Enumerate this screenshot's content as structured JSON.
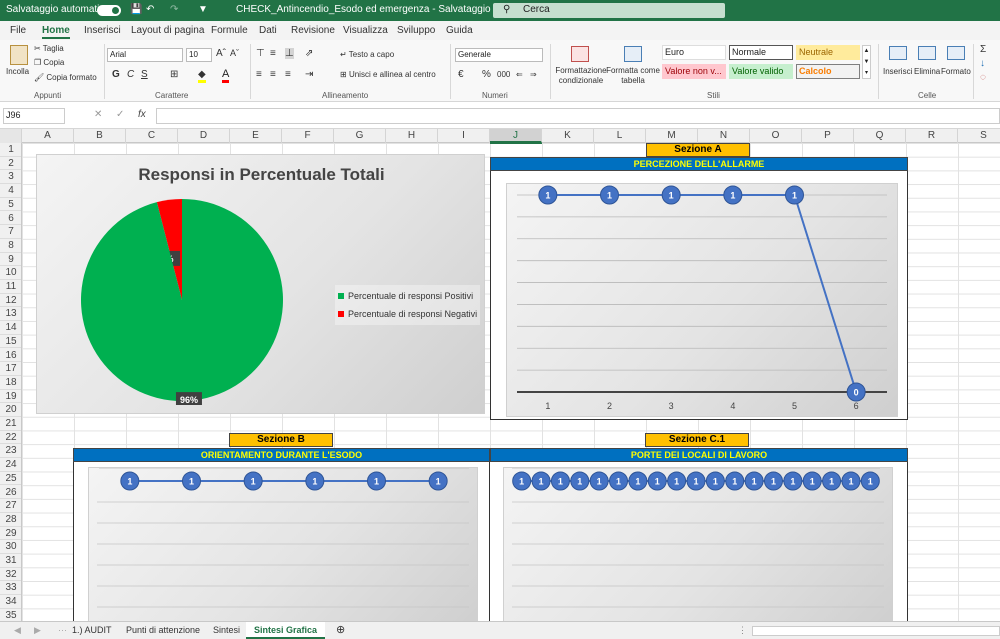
{
  "titlebar": {
    "autosave": "Salvataggio automatico",
    "filename": "CHECK_Antincendio_Esodo ed emergenza - Salvataggio completato",
    "search": "Cerca"
  },
  "tabs": [
    "File",
    "Home",
    "Inserisci",
    "Layout di pagina",
    "Formule",
    "Dati",
    "Revisione",
    "Visualizza",
    "Sviluppo",
    "Guida"
  ],
  "ribbon": {
    "clipboard": {
      "paste": "Incolla",
      "cut": "Taglia",
      "copy": "Copia",
      "format_painter": "Copia formato",
      "label": "Appunti"
    },
    "font": {
      "name": "Arial",
      "size": "10",
      "label": "Carattere",
      "bold": "G",
      "italic": "C",
      "underline": "S"
    },
    "alignment": {
      "wrap": "Testo a capo",
      "merge": "Unisci e allinea al centro",
      "label": "Allineamento"
    },
    "number": {
      "format": "Generale",
      "label": "Numeri"
    },
    "styles": {
      "cond": "Formattazione condizionale",
      "table": "Formatta come tabella",
      "euro": "Euro",
      "normale": "Normale",
      "neutrale": "Neutrale",
      "non_valido": "Valore non v...",
      "valido": "Valore valido",
      "calcolo": "Calcolo",
      "label": "Stili"
    },
    "cells": {
      "insert": "Inserisci",
      "delete": "Elimina",
      "format": "Formato",
      "label": "Celle"
    }
  },
  "formula_bar": {
    "name_box": "J96",
    "fx": "fx"
  },
  "columns": [
    "A",
    "B",
    "C",
    "D",
    "E",
    "F",
    "G",
    "H",
    "I",
    "J",
    "K",
    "L",
    "M",
    "N",
    "O",
    "P",
    "Q",
    "R",
    "S"
  ],
  "rows": [
    "1",
    "2",
    "3",
    "4",
    "5",
    "6",
    "7",
    "8",
    "9",
    "10",
    "11",
    "12",
    "13",
    "14",
    "15",
    "16",
    "17",
    "18",
    "19",
    "20",
    "21",
    "22",
    "23",
    "24",
    "25",
    "26",
    "27",
    "28",
    "29",
    "30",
    "31",
    "32",
    "33",
    "34",
    "35"
  ],
  "sections": {
    "a_title": "Sezione A",
    "a_sub": "PERCEZIONE DELL'ALLARME",
    "b_title": "Sezione B",
    "b_sub": "ORIENTAMENTO DURANTE L'ESODO",
    "c_title": "Sezione C.1",
    "c_sub": "PORTE DEI LOCALI DI LAVORO"
  },
  "chart_data": [
    {
      "type": "pie",
      "title": "Responsi in Percentuale Totali",
      "series": [
        {
          "name": "Percentuale di responsi Positivi",
          "value": 96,
          "label": "96%",
          "color": "#00b050"
        },
        {
          "name": "Percentuale di responsi Negativi",
          "value": 4,
          "label": "4%",
          "color": "#ff0000"
        }
      ],
      "legend": "right"
    },
    {
      "type": "line",
      "categories": [
        "1",
        "2",
        "3",
        "4",
        "5",
        "6"
      ],
      "values": [
        1,
        1,
        1,
        1,
        1,
        0
      ],
      "ylim": [
        0,
        1
      ],
      "color": "#4472c4"
    },
    {
      "type": "line",
      "values": [
        1,
        1,
        1,
        1,
        1,
        1
      ],
      "ylim": [
        0,
        1
      ],
      "color": "#4472c4"
    },
    {
      "type": "line",
      "values": [
        1,
        1,
        1,
        1,
        1,
        1,
        1,
        1,
        1,
        1,
        1,
        1,
        1,
        1,
        1,
        1,
        1,
        1,
        1
      ],
      "ylim": [
        0,
        1
      ],
      "color": "#4472c4"
    }
  ],
  "sheets": [
    "1.) AUDIT",
    "Punti di attenzione",
    "Sintesi",
    "Sintesi Grafica"
  ],
  "active_sheet": "Sintesi Grafica"
}
